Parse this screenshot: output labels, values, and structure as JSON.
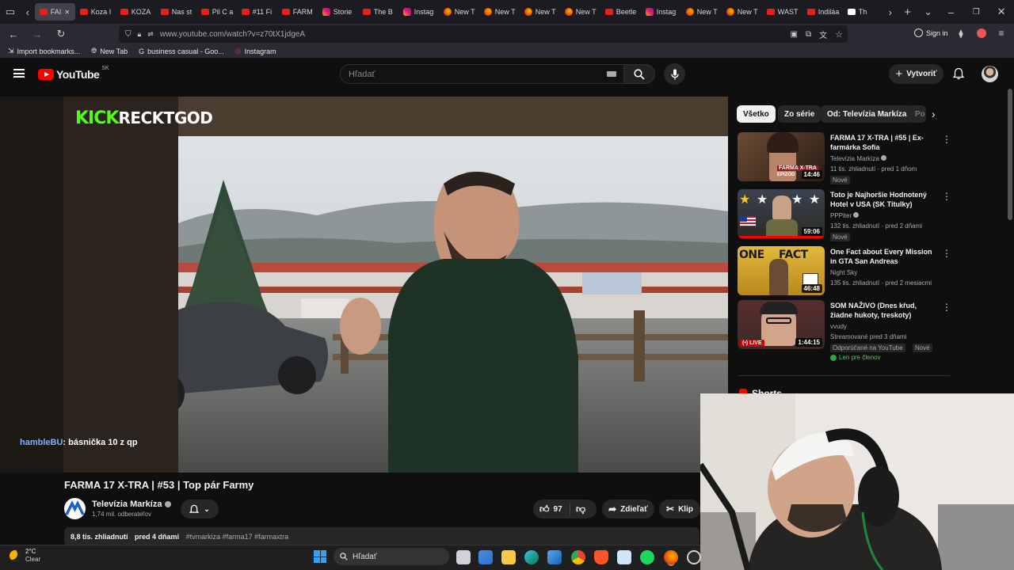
{
  "browser": {
    "tabs": [
      {
        "label": "FAI",
        "icon": "youtube-icon",
        "active": true
      },
      {
        "label": "Koza I",
        "icon": "youtube-icon"
      },
      {
        "label": "KOZA",
        "icon": "youtube-icon"
      },
      {
        "label": "Nas st",
        "icon": "youtube-icon"
      },
      {
        "label": "Pil C a",
        "icon": "youtube-icon"
      },
      {
        "label": "#11 Fi",
        "icon": "youtube-icon"
      },
      {
        "label": "FARM",
        "icon": "youtube-icon"
      },
      {
        "label": "Storie",
        "icon": "instagram-icon"
      },
      {
        "label": "The B",
        "icon": "youtube-icon"
      },
      {
        "label": "Instag",
        "icon": "instagram-icon"
      },
      {
        "label": "New T",
        "icon": "firefox-icon"
      },
      {
        "label": "New T",
        "icon": "firefox-icon"
      },
      {
        "label": "New T",
        "icon": "firefox-icon"
      },
      {
        "label": "New T",
        "icon": "firefox-icon"
      },
      {
        "label": "Beetle",
        "icon": "youtube-icon"
      },
      {
        "label": "Instag",
        "icon": "instagram-icon"
      },
      {
        "label": "New T",
        "icon": "firefox-icon"
      },
      {
        "label": "New T",
        "icon": "firefox-icon"
      },
      {
        "label": "WAST",
        "icon": "youtube-icon"
      },
      {
        "label": "Indiláa",
        "icon": "youtube-icon"
      },
      {
        "label": "Th",
        "icon": "kick-icon"
      }
    ],
    "url_host": "www.youtube.com",
    "url_path": "/watch?v=z70tX1jdgeA",
    "sign_in": "Sign in",
    "bookmarks": [
      {
        "label": "Import bookmarks...",
        "icon": "import-icon"
      },
      {
        "label": "New Tab",
        "icon": "globe-icon"
      },
      {
        "label": "business casual - Goo...",
        "icon": "google-icon"
      },
      {
        "label": "Instagram",
        "icon": "instagram-icon"
      }
    ]
  },
  "youtube": {
    "logo_text": "YouTube",
    "region": "SK",
    "search_placeholder": "Hľadať",
    "create_label": "Vytvoriť"
  },
  "video": {
    "overlay_brand": "KICK",
    "overlay_channel": "RECKTGOD",
    "chat_user": "hambleBU",
    "chat_message": ": básnička 10 z qp",
    "title": "FARMA 17 X-TRA | #53 | Top pár Farmy",
    "channel": "Televízia Markíza",
    "subscribers": "1,74 mil. odberateľov",
    "likes": "97",
    "share_label": "Zdieľať",
    "clip_label": "Klip",
    "views": "8,8 tis. zhliadnutí",
    "date": "pred 4 dňami",
    "hashtags": "#tvmarkiza #farma17 #farmaxtra"
  },
  "chips": [
    "Všetko",
    "Zo série",
    "Od: Televízia Markíza",
    "Po"
  ],
  "recommendations": [
    {
      "title": "FARMA 17 X-TRA | #55 | Ex-farmárka Sofia",
      "channel": "Televízia Markíza",
      "verified": true,
      "meta": "11 tis. zhliadnutí · pred 1 dňom",
      "badges": [
        "Nové"
      ],
      "duration": "14:46",
      "thumb_text": "FARMA X-TRA",
      "thumb_text2": "EPIZÓD"
    },
    {
      "title": "Toto je Najhoršie Hodnotený Hotel v USA (SK Titulky)",
      "channel": "PPPiter",
      "verified": true,
      "meta": "132 tis. zhliadnutí · pred 2 dňami",
      "badges": [
        "Nové"
      ],
      "duration": "59:06"
    },
    {
      "title": "One Fact about Every Mission in GTA San Andreas",
      "channel": "Night Sky",
      "verified": false,
      "meta": "135 tis. zhliadnutí · pred 2 mesiacmi",
      "badges": [],
      "duration": "46:48",
      "thumb_text": "ONE FACT"
    },
    {
      "title": "SOM NAŽIVO (Dnes křud, žiadne hukoty, treskoty)",
      "channel": "vvudy",
      "verified": false,
      "meta": "Streamované pred 3 dňami",
      "badges": [
        "Odporúčané na YouTube",
        "Nové"
      ],
      "duration": "1:44:15",
      "live_label": "LIVE",
      "members": "Len pre členov"
    }
  ],
  "shorts_label": "Shorts",
  "taskbar": {
    "temperature": "2°C",
    "weather": "Clear",
    "search_placeholder": "Hľadať"
  }
}
